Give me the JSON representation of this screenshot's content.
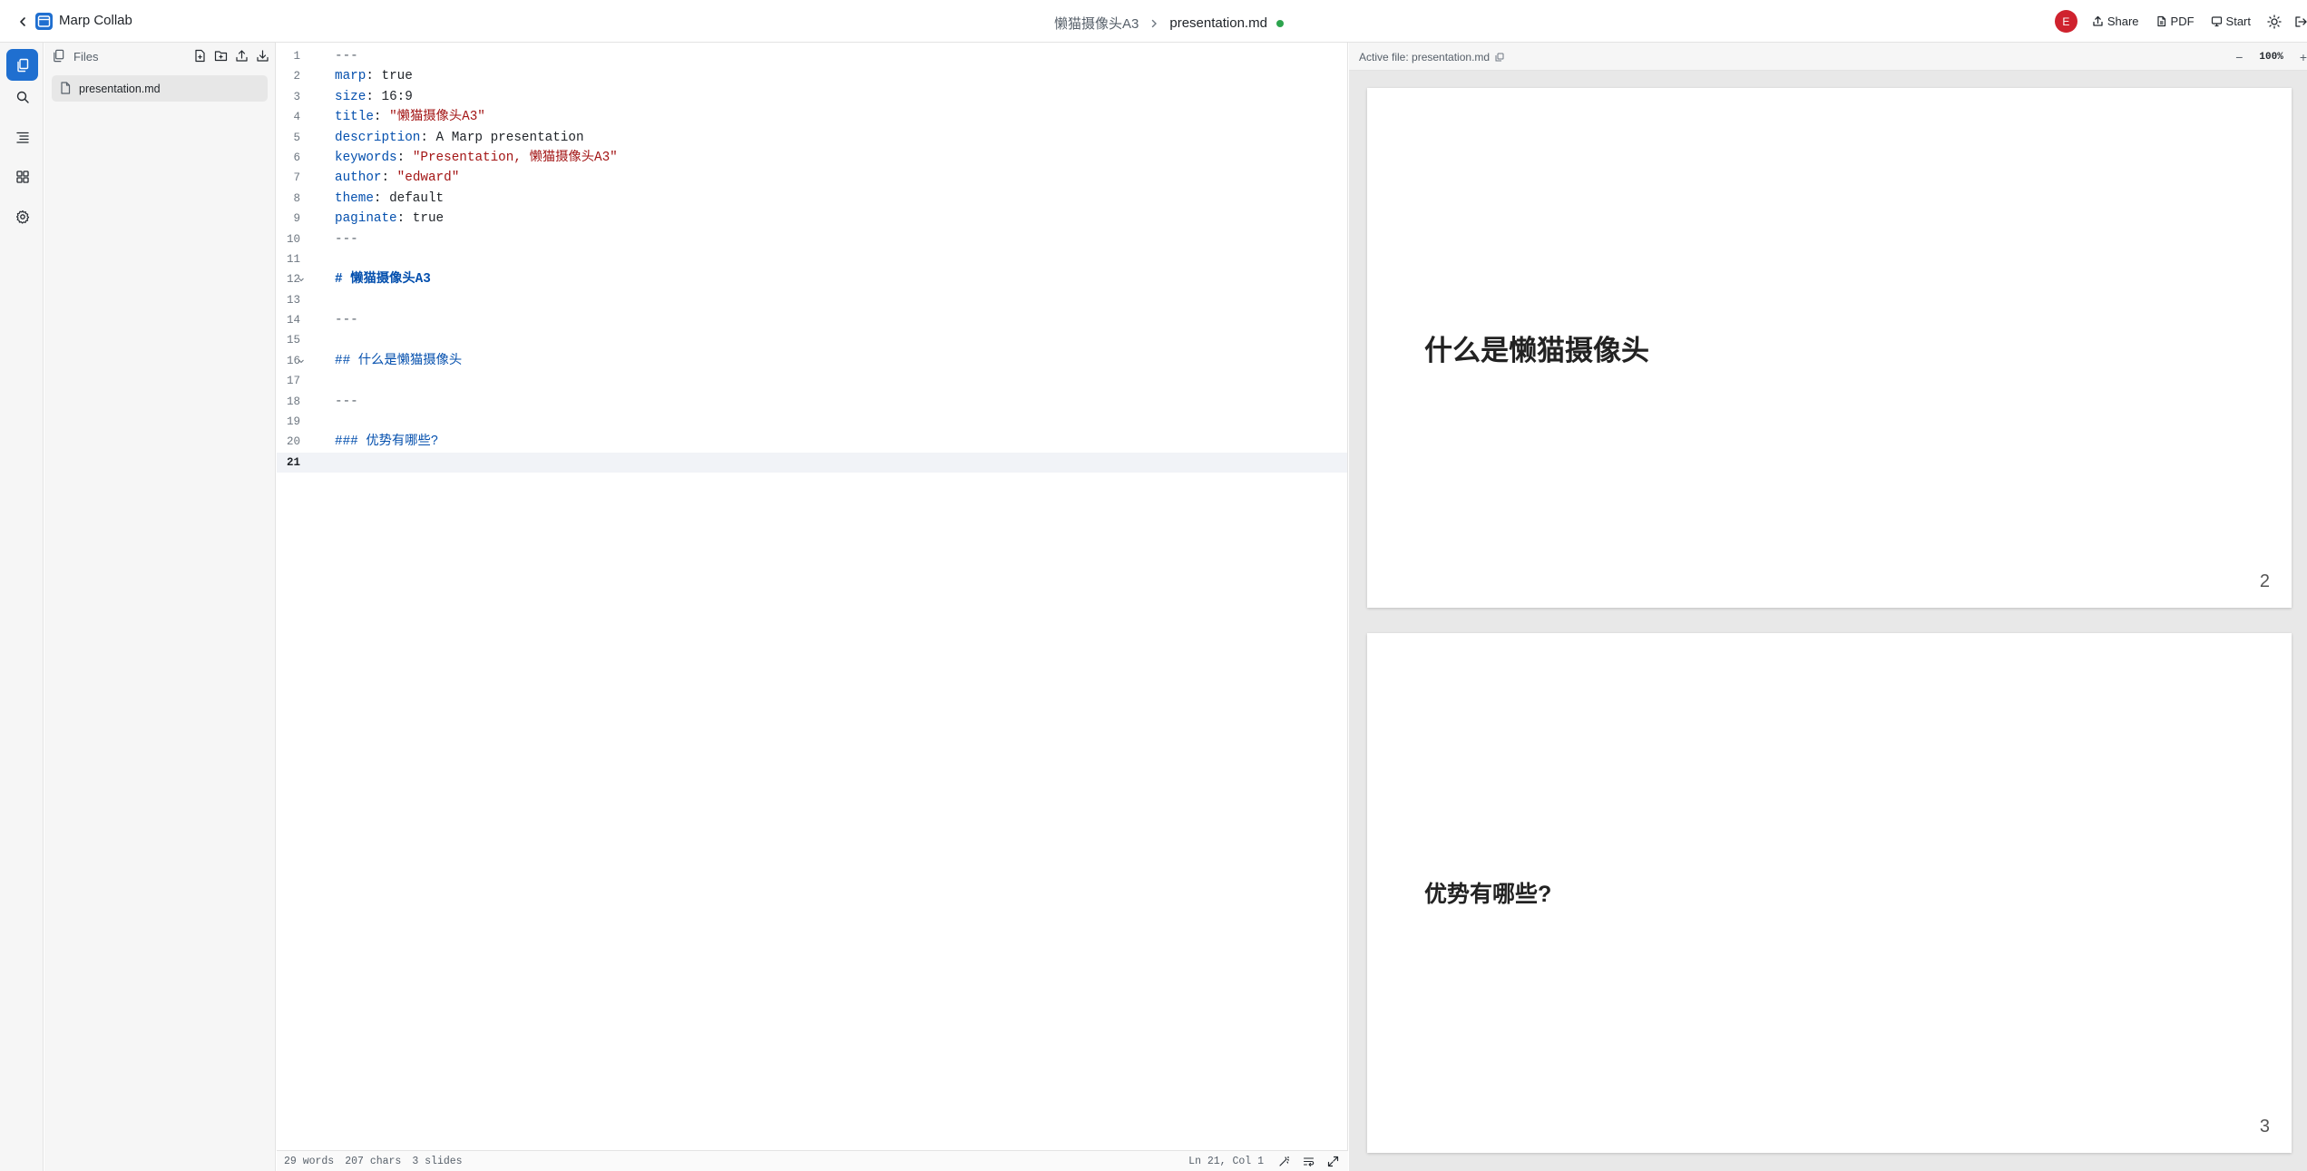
{
  "header": {
    "app_title": "Marp Collab",
    "project_name": "懒猫摄像头A3",
    "file_name": "presentation.md",
    "avatar_initial": "E",
    "share_label": "Share",
    "pdf_label": "PDF",
    "start_label": "Start",
    "sync_status_color": "#2da44e",
    "avatar_color": "#cf222e"
  },
  "activity_bar": {
    "items": [
      "files-icon",
      "search-icon",
      "outline-icon",
      "grid-icon",
      "gear-icon"
    ],
    "active": "files-icon",
    "accent_color": "#1f6fd0"
  },
  "explorer": {
    "title": "Files",
    "tools": [
      "new-file-icon",
      "new-folder-icon",
      "upload-icon",
      "download-icon"
    ],
    "files": [
      {
        "name": "presentation.md",
        "selected": true
      }
    ]
  },
  "editor": {
    "lines": [
      {
        "n": "1",
        "parts": [
          [
            "hr",
            "---"
          ]
        ]
      },
      {
        "n": "2",
        "parts": [
          [
            "k",
            "marp"
          ],
          [
            "p",
            ": true"
          ]
        ]
      },
      {
        "n": "3",
        "parts": [
          [
            "k",
            "size"
          ],
          [
            "p",
            ": 16:9"
          ]
        ]
      },
      {
        "n": "4",
        "parts": [
          [
            "k",
            "title"
          ],
          [
            "p",
            ": "
          ],
          [
            "s",
            "\"懒猫摄像头A3\""
          ]
        ]
      },
      {
        "n": "5",
        "parts": [
          [
            "k",
            "description"
          ],
          [
            "p",
            ": A Marp presentation"
          ]
        ]
      },
      {
        "n": "6",
        "parts": [
          [
            "k",
            "keywords"
          ],
          [
            "p",
            ": "
          ],
          [
            "s",
            "\"Presentation, 懒猫摄像头A3\""
          ]
        ]
      },
      {
        "n": "7",
        "parts": [
          [
            "k",
            "author"
          ],
          [
            "p",
            ": "
          ],
          [
            "s",
            "\"edward\""
          ]
        ]
      },
      {
        "n": "8",
        "parts": [
          [
            "k",
            "theme"
          ],
          [
            "p",
            ": default"
          ]
        ]
      },
      {
        "n": "9",
        "parts": [
          [
            "k",
            "paginate"
          ],
          [
            "p",
            ": true"
          ]
        ]
      },
      {
        "n": "10",
        "parts": [
          [
            "hr",
            "---"
          ]
        ]
      },
      {
        "n": "11",
        "parts": []
      },
      {
        "n": "12",
        "fold": true,
        "parts": [
          [
            "h1",
            "# 懒猫摄像头A3"
          ]
        ]
      },
      {
        "n": "13",
        "parts": []
      },
      {
        "n": "14",
        "parts": [
          [
            "hr",
            "---"
          ]
        ]
      },
      {
        "n": "15",
        "parts": []
      },
      {
        "n": "16",
        "fold": true,
        "parts": [
          [
            "h2",
            "## 什么是懒猫摄像头"
          ]
        ]
      },
      {
        "n": "17",
        "parts": []
      },
      {
        "n": "18",
        "parts": [
          [
            "hr",
            "---"
          ]
        ]
      },
      {
        "n": "19",
        "parts": []
      },
      {
        "n": "20",
        "parts": [
          [
            "h2",
            "### 优势有哪些?"
          ]
        ]
      },
      {
        "n": "21",
        "current": true,
        "parts": []
      }
    ]
  },
  "status_bar": {
    "words": "29 words",
    "chars": "207 chars",
    "slides": "3 slides",
    "cursor": "Ln 21, Col 1"
  },
  "preview": {
    "active_file_label": "Active file: presentation.md",
    "zoom": "100%",
    "zoom_out": "−",
    "zoom_in": "+",
    "slides": [
      {
        "title": "什么是懒猫摄像头",
        "page": "2",
        "level": "h2"
      },
      {
        "title": "优势有哪些?",
        "page": "3",
        "level": "h3"
      }
    ]
  }
}
